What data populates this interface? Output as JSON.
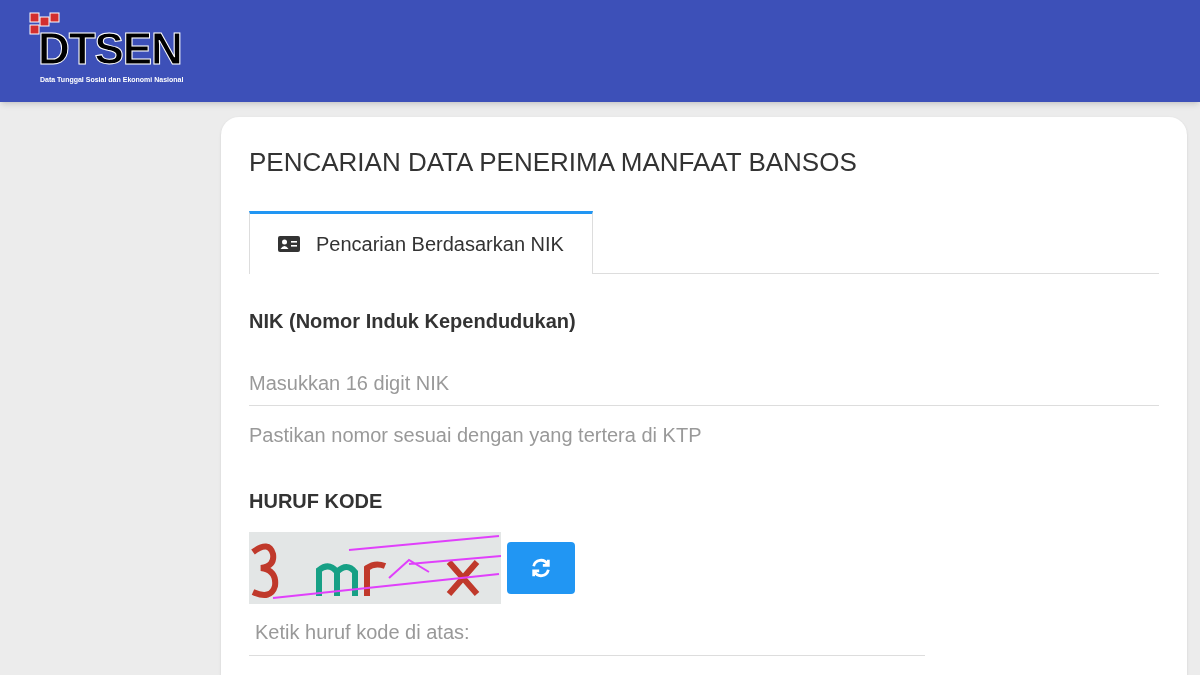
{
  "header": {
    "logo": {
      "name": "DTSEN",
      "tagline": "Data Tunggal Sosial dan Ekonomi Nasional"
    }
  },
  "card": {
    "title": "PENCARIAN DATA PENERIMA MANFAAT BANSOS",
    "tabs": [
      {
        "label": "Pencarian Berdasarkan NIK",
        "selected": true
      }
    ],
    "nik": {
      "label": "NIK (Nomor Induk Kependudukan)",
      "placeholder": "Masukkan 16 digit NIK",
      "hint": "Pastikan nomor sesuai dengan yang tertera di KTP"
    },
    "captcha": {
      "label": "HURUF KODE",
      "placeholder": "Ketik huruf kode di atas:"
    }
  }
}
